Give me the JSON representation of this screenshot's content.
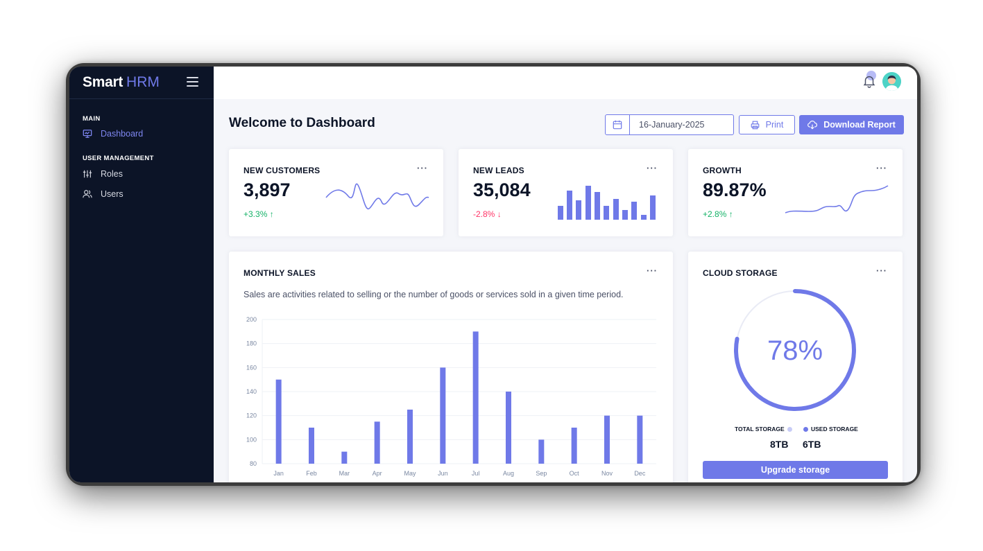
{
  "brand": {
    "strong": "Smart",
    "light": "HRM"
  },
  "sidebar": {
    "sections": [
      {
        "title": "MAIN",
        "items": [
          {
            "label": "Dashboard",
            "icon": "monitor-icon",
            "active": true
          }
        ]
      },
      {
        "title": "USER MANAGEMENT",
        "items": [
          {
            "label": "Roles",
            "icon": "sliders-icon"
          },
          {
            "label": "Users",
            "icon": "users-icon"
          }
        ]
      }
    ]
  },
  "header": {
    "title": "Welcome to Dashboard",
    "date": "16-January-2025",
    "print_label": "Print",
    "download_label": "Download Report"
  },
  "stats": [
    {
      "title": "NEW CUSTOMERS",
      "value": "3,897",
      "change": "+3.3%",
      "trend": "up"
    },
    {
      "title": "NEW LEADS",
      "value": "35,084",
      "change": "-2.8%",
      "trend": "down"
    },
    {
      "title": "GROWTH",
      "value": "89.87%",
      "change": "+2.8%",
      "trend": "up"
    }
  ],
  "more_label": "···",
  "monthly_sales": {
    "title": "MONTHLY SALES",
    "description": "Sales are activities related to selling or the number of goods or services sold in a given time period."
  },
  "cloud_storage": {
    "title": "CLOUD STORAGE",
    "percent_label": "78%",
    "percent": 78,
    "total_label": "TOTAL STORAGE",
    "used_label": "USED STORAGE",
    "total_value": "8TB",
    "used_value": "6TB",
    "upgrade_label": "Upgrade storage"
  },
  "colors": {
    "accent": "#6f79e8",
    "sidebar": "#0c1427",
    "up": "#14b267",
    "down": "#ff3366",
    "track": "#e9ebf5"
  },
  "chart_data": {
    "type": "bar",
    "categories": [
      "Jan",
      "Feb",
      "Mar",
      "Apr",
      "May",
      "Jun",
      "Jul",
      "Aug",
      "Sep",
      "Oct",
      "Nov",
      "Dec"
    ],
    "values": [
      150,
      110,
      90,
      115,
      125,
      160,
      190,
      140,
      100,
      110,
      120,
      120
    ],
    "ylim": [
      80,
      200
    ],
    "yticks": [
      80,
      100,
      120,
      140,
      160,
      180,
      200
    ],
    "grid": true
  }
}
